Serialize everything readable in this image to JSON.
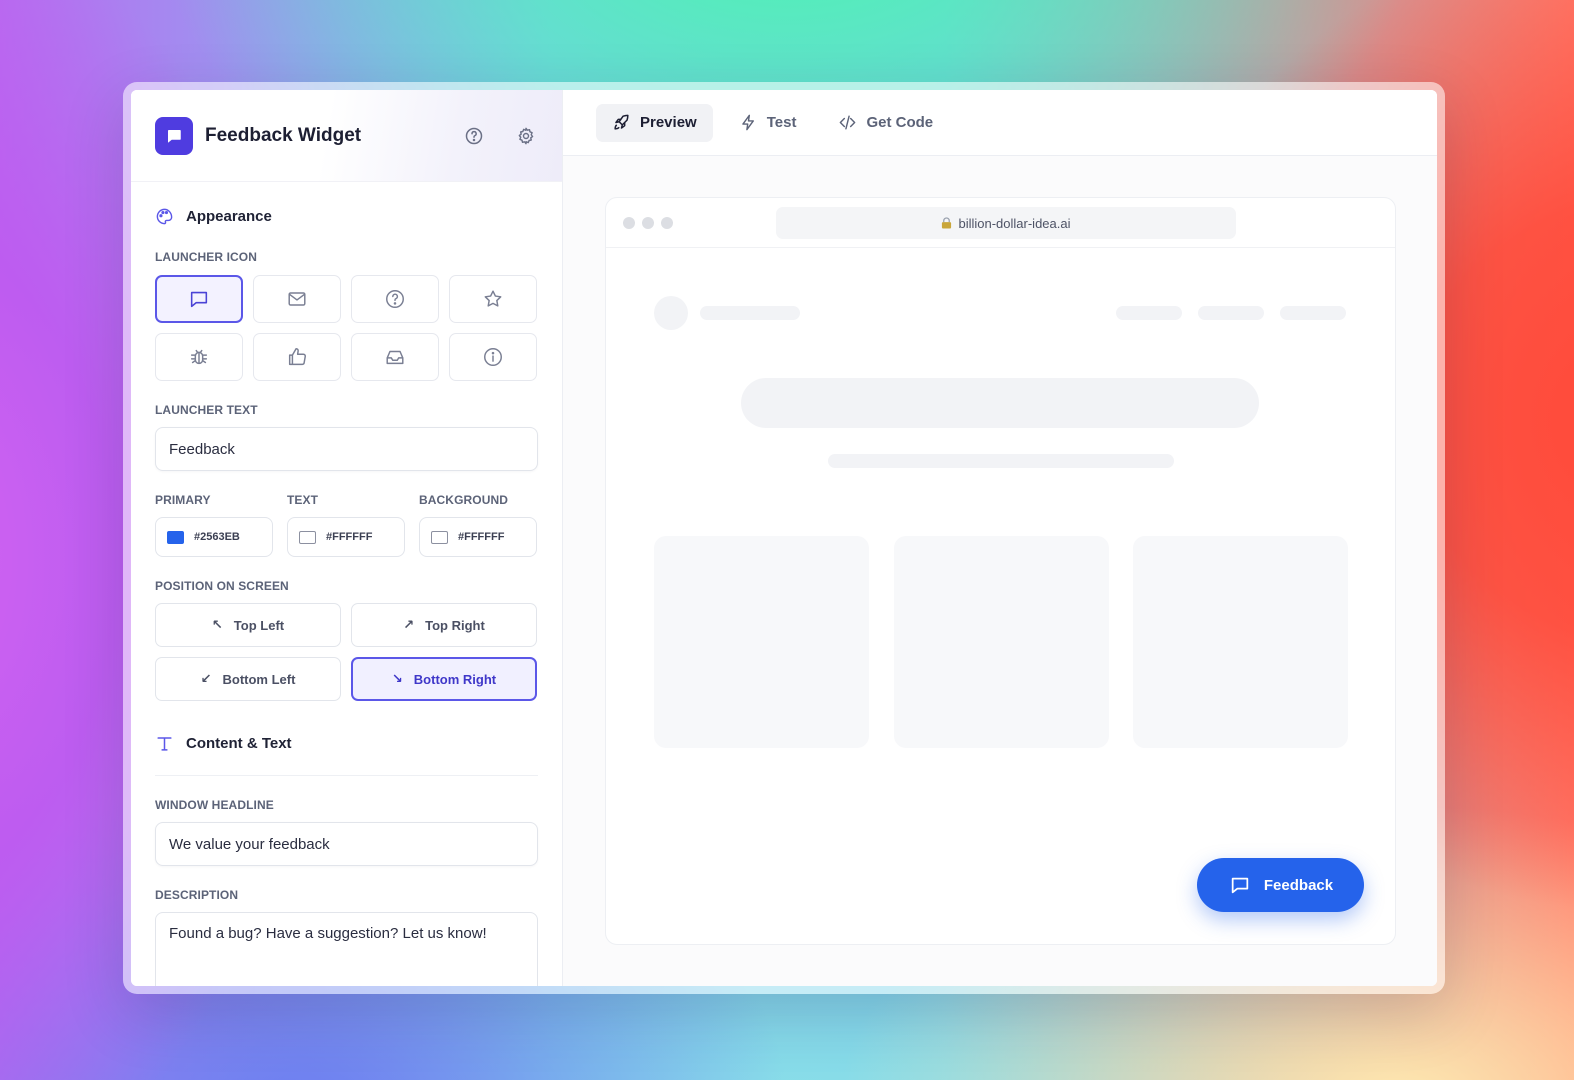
{
  "app": {
    "title": "Feedback Widget",
    "logo_color": "#4F3CE0"
  },
  "header_icons": [
    "help-icon",
    "gear-icon"
  ],
  "appearance": {
    "section_title": "Appearance",
    "launcher_icon_label": "LAUNCHER ICON",
    "launcher_icons": [
      "chat-icon",
      "mail-icon",
      "help-circle-icon",
      "star-icon",
      "bug-icon",
      "thumbs-up-icon",
      "inbox-icon",
      "info-icon"
    ],
    "selected_icon": "chat-icon",
    "launcher_text_label": "LAUNCHER TEXT",
    "launcher_text_value": "Feedback",
    "colors": {
      "primary_label": "PRIMARY",
      "primary_value": "#2563EB",
      "text_label": "TEXT",
      "text_value": "#FFFFFF",
      "background_label": "BACKGROUND",
      "background_value": "#FFFFFF"
    },
    "position_label": "POSITION ON SCREEN",
    "positions": {
      "top_left": "Top Left",
      "top_right": "Top Right",
      "bottom_left": "Bottom Left",
      "bottom_right": "Bottom Right"
    },
    "selected_position": "Bottom Right"
  },
  "content": {
    "section_title": "Content & Text",
    "headline_label": "WINDOW HEADLINE",
    "headline_value": "We value your feedback",
    "description_label": "DESCRIPTION",
    "description_value": "Found a bug? Have a suggestion? Let us know!"
  },
  "tabs": {
    "preview": "Preview",
    "test": "Test",
    "get_code": "Get Code",
    "active": "Preview"
  },
  "preview": {
    "url": "billion-dollar-idea.ai",
    "launcher_label": "Feedback",
    "launcher_color": "#2563EB"
  }
}
